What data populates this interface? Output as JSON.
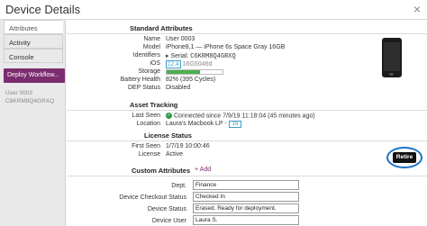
{
  "window": {
    "title": "Device Details",
    "close_label": "×"
  },
  "sidebar": {
    "items": [
      {
        "label": "Attributes",
        "active": true
      },
      {
        "label": "Activity",
        "active": false
      },
      {
        "label": "Console",
        "active": false
      }
    ],
    "deploy_label": "Deploy Workflow...",
    "device_user": "User 0003",
    "device_serial": "C6KRM8Q4GRXQ"
  },
  "standard": {
    "title": "Standard Attributes",
    "name_label": "Name",
    "name": "User 0003",
    "model_label": "Model",
    "model": "iPhone8,1 — iPhone 6s Space Gray 16GB",
    "identifiers_label": "Identifiers",
    "serial_prefix": "▸ Serial:",
    "serial": "C6KRM8Q4GRXQ",
    "ios_label": "iOS",
    "ios_version": "12.4",
    "ios_build": "16G5046d",
    "storage_label": "Storage",
    "storage_used_fraction": 0.6,
    "battery_label": "Battery Health",
    "battery": "82% (395 Cycles)",
    "dep_label": "DEP Status",
    "dep": "Disabled"
  },
  "asset": {
    "title": "Asset Tracking",
    "last_seen_label": "Last Seen",
    "last_seen": "Connected since 7/9/19 11:18:04 (45 minutes ago)",
    "location_label": "Location",
    "location": "Laura's Macbook LP -",
    "location_badge": "16"
  },
  "license": {
    "title": "License Status",
    "first_seen_label": "First Seen",
    "first_seen": "1/7/19 10:00:46",
    "license_label": "License",
    "license": "Active",
    "retire_label": "Retire"
  },
  "custom": {
    "title": "Custom Attributes",
    "add_label": "+ Add",
    "fields": [
      {
        "label": "Dept.",
        "value": "Finance"
      },
      {
        "label": "Device Checkout Status",
        "value": "Checked In"
      },
      {
        "label": "Device Status",
        "value": "Erased. Ready for deployment."
      },
      {
        "label": "Device User",
        "value": "Laura S."
      }
    ]
  },
  "icons": {
    "close": "close-icon",
    "check": "check-circle-icon",
    "device": "iphone-image"
  },
  "colors": {
    "accent": "#7b2c6e",
    "link": "#3a9cc7",
    "success": "#2e9d48",
    "highlight": "#1a73c8"
  }
}
